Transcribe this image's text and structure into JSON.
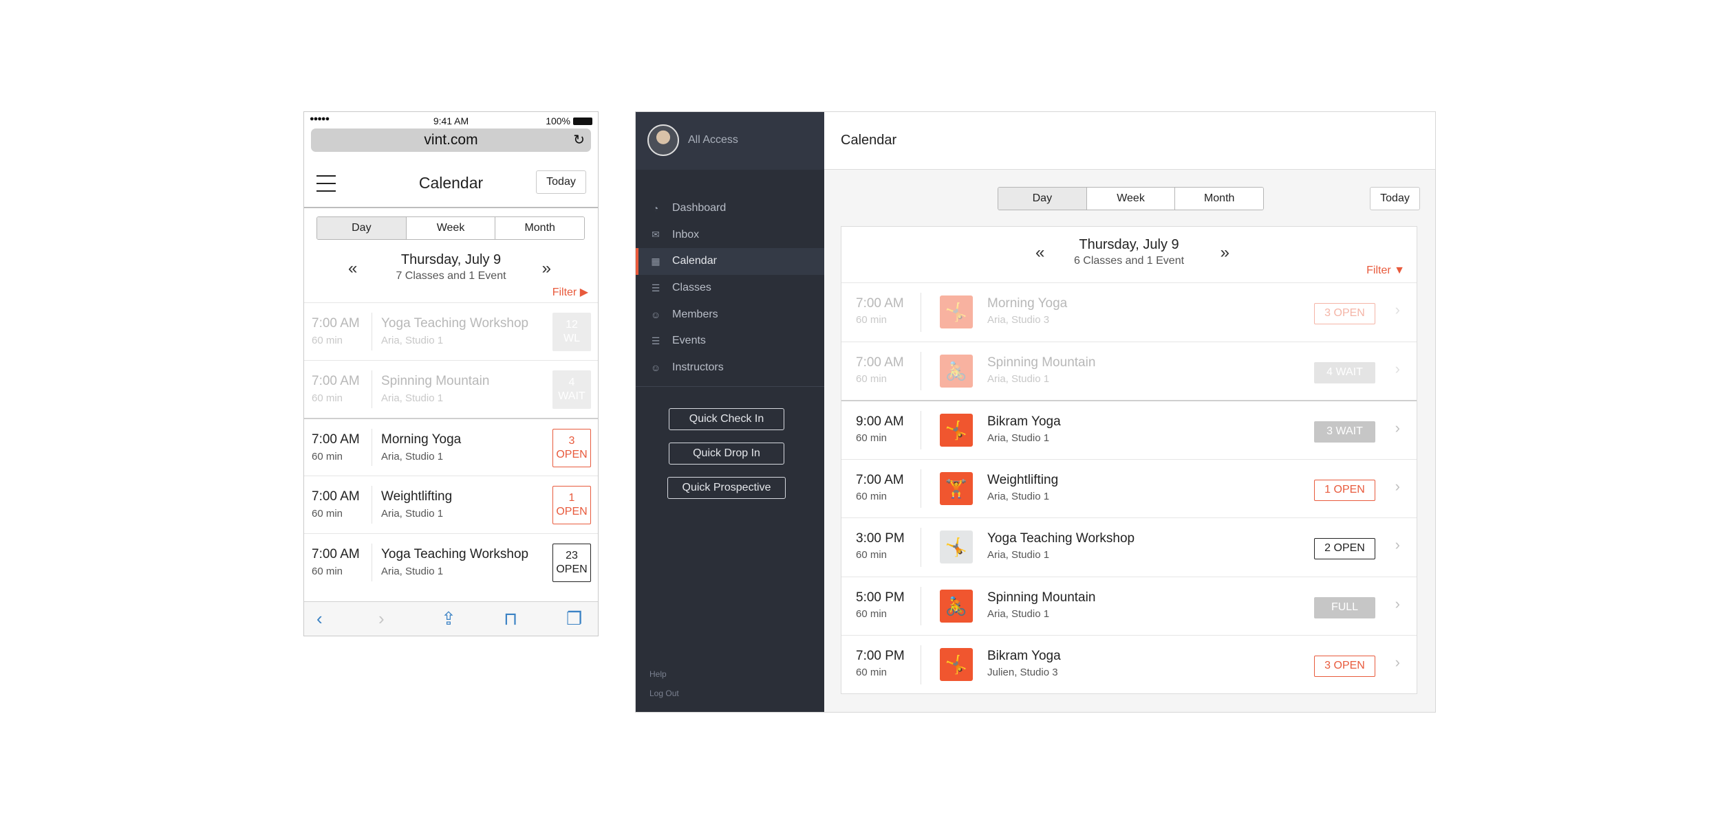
{
  "phone": {
    "status": {
      "signal": "●●●●●",
      "time": "9:41 AM",
      "battery": "100%"
    },
    "url": "vint.com",
    "reload_glyph": "↻",
    "header": {
      "title": "Calendar",
      "today": "Today"
    },
    "segments": [
      "Day",
      "Week",
      "Month"
    ],
    "active_segment": "Day",
    "date": "Thursday, July 9",
    "summary": "7 Classes and 1 Event",
    "filter": "Filter ▶",
    "rows": [
      {
        "time": "7:00 AM",
        "duration": "60 min",
        "name": "Yoga Teaching Workshop",
        "location": "Aria, Studio 1",
        "badge_num": "12",
        "badge_text": "WL",
        "badge_style": "fade",
        "dim": true
      },
      {
        "time": "7:00 AM",
        "duration": "60 min",
        "name": "Spinning Mountain",
        "location": "Aria, Studio 1",
        "badge_num": "4",
        "badge_text": "WAIT",
        "badge_style": "fade",
        "dim": true
      },
      {
        "time": "7:00 AM",
        "duration": "60 min",
        "name": "Morning Yoga",
        "location": "Aria, Studio 1",
        "badge_num": "3",
        "badge_text": "OPEN",
        "badge_style": "open",
        "dim": false
      },
      {
        "time": "7:00 AM",
        "duration": "60 min",
        "name": "Weightlifting",
        "location": "Aria, Studio 1",
        "badge_num": "1",
        "badge_text": "OPEN",
        "badge_style": "open",
        "dim": false
      },
      {
        "time": "7:00 AM",
        "duration": "60 min",
        "name": "Yoga Teaching Workshop",
        "location": "Aria, Studio 1",
        "badge_num": "23",
        "badge_text": "OPEN",
        "badge_style": "dark",
        "dim": false
      }
    ],
    "toolbar": {
      "back": "‹",
      "forward": "›",
      "share": "⇪",
      "bookmarks": "⊓",
      "tabs": "❐"
    }
  },
  "tablet": {
    "account": "All Access",
    "nav": [
      {
        "label": "Dashboard",
        "icon": "dashboard-icon",
        "glyph": "◔"
      },
      {
        "label": "Inbox",
        "icon": "inbox-icon",
        "glyph": "✉"
      },
      {
        "label": "Calendar",
        "icon": "calendar-icon",
        "glyph": "▦"
      },
      {
        "label": "Classes",
        "icon": "classes-icon",
        "glyph": "☰"
      },
      {
        "label": "Members",
        "icon": "members-icon",
        "glyph": "☺"
      },
      {
        "label": "Events",
        "icon": "events-icon",
        "glyph": "☰"
      },
      {
        "label": "Instructors",
        "icon": "instructors-icon",
        "glyph": "☺"
      }
    ],
    "active_nav": "Calendar",
    "quick": [
      "Quick Check In",
      "Quick Drop In",
      "Quick Prospective"
    ],
    "footer": [
      "Help",
      "Log Out"
    ],
    "title": "Calendar",
    "segments": [
      "Day",
      "Week",
      "Month"
    ],
    "active_segment": "Day",
    "today": "Today",
    "date": "Thursday, July 9",
    "summary": "6 Classes and 1 Event",
    "filter": "Filter ▼",
    "rows": [
      {
        "time": "7:00 AM",
        "duration": "60 min",
        "name": "Morning Yoga",
        "location": "Aria, Studio 3",
        "badge": "3 OPEN",
        "badge_style": "open",
        "icon": "yoga-icon",
        "icon_glyph": "🤸",
        "icon_style": "orange",
        "dim": true
      },
      {
        "time": "7:00 AM",
        "duration": "60 min",
        "name": "Spinning Mountain",
        "location": "Aria, Studio 1",
        "badge": "4 WAIT",
        "badge_style": "grey",
        "icon": "spinning-icon",
        "icon_glyph": "🚴",
        "icon_style": "orange",
        "dim": true
      },
      {
        "time": "9:00 AM",
        "duration": "60 min",
        "name": "Bikram Yoga",
        "location": "Aria, Studio 1",
        "badge": "3 WAIT",
        "badge_style": "grey",
        "icon": "yoga-icon",
        "icon_glyph": "🤸",
        "icon_style": "orange",
        "dim": false
      },
      {
        "time": "7:00 AM",
        "duration": "60 min",
        "name": "Weightlifting",
        "location": "Aria, Studio 1",
        "badge": "1 OPEN",
        "badge_style": "open",
        "icon": "weightlifting-icon",
        "icon_glyph": "🏋",
        "icon_style": "orange",
        "dim": false
      },
      {
        "time": "3:00 PM",
        "duration": "60 min",
        "name": "Yoga Teaching Workshop",
        "location": "Aria, Studio 1",
        "badge": "2 OPEN",
        "badge_style": "dark",
        "icon": "yoga-icon",
        "icon_glyph": "🤸",
        "icon_style": "dark",
        "dim": false
      },
      {
        "time": "5:00 PM",
        "duration": "60 min",
        "name": "Spinning Mountain",
        "location": "Aria, Studio 1",
        "badge": "FULL",
        "badge_style": "grey",
        "icon": "spinning-icon",
        "icon_glyph": "🚴",
        "icon_style": "orange",
        "dim": false
      },
      {
        "time": "7:00 PM",
        "duration": "60 min",
        "name": "Bikram Yoga",
        "location": "Julien, Studio 3",
        "badge": "3 OPEN",
        "badge_style": "open",
        "icon": "yoga-icon",
        "icon_glyph": "🤸",
        "icon_style": "orange",
        "dim": false
      }
    ],
    "chevron": "›",
    "prev": "«",
    "next": "»"
  },
  "colors": {
    "accent": "#e85a3c",
    "sidebar": "#2b2f38",
    "icon_orange": "#f0562f"
  }
}
